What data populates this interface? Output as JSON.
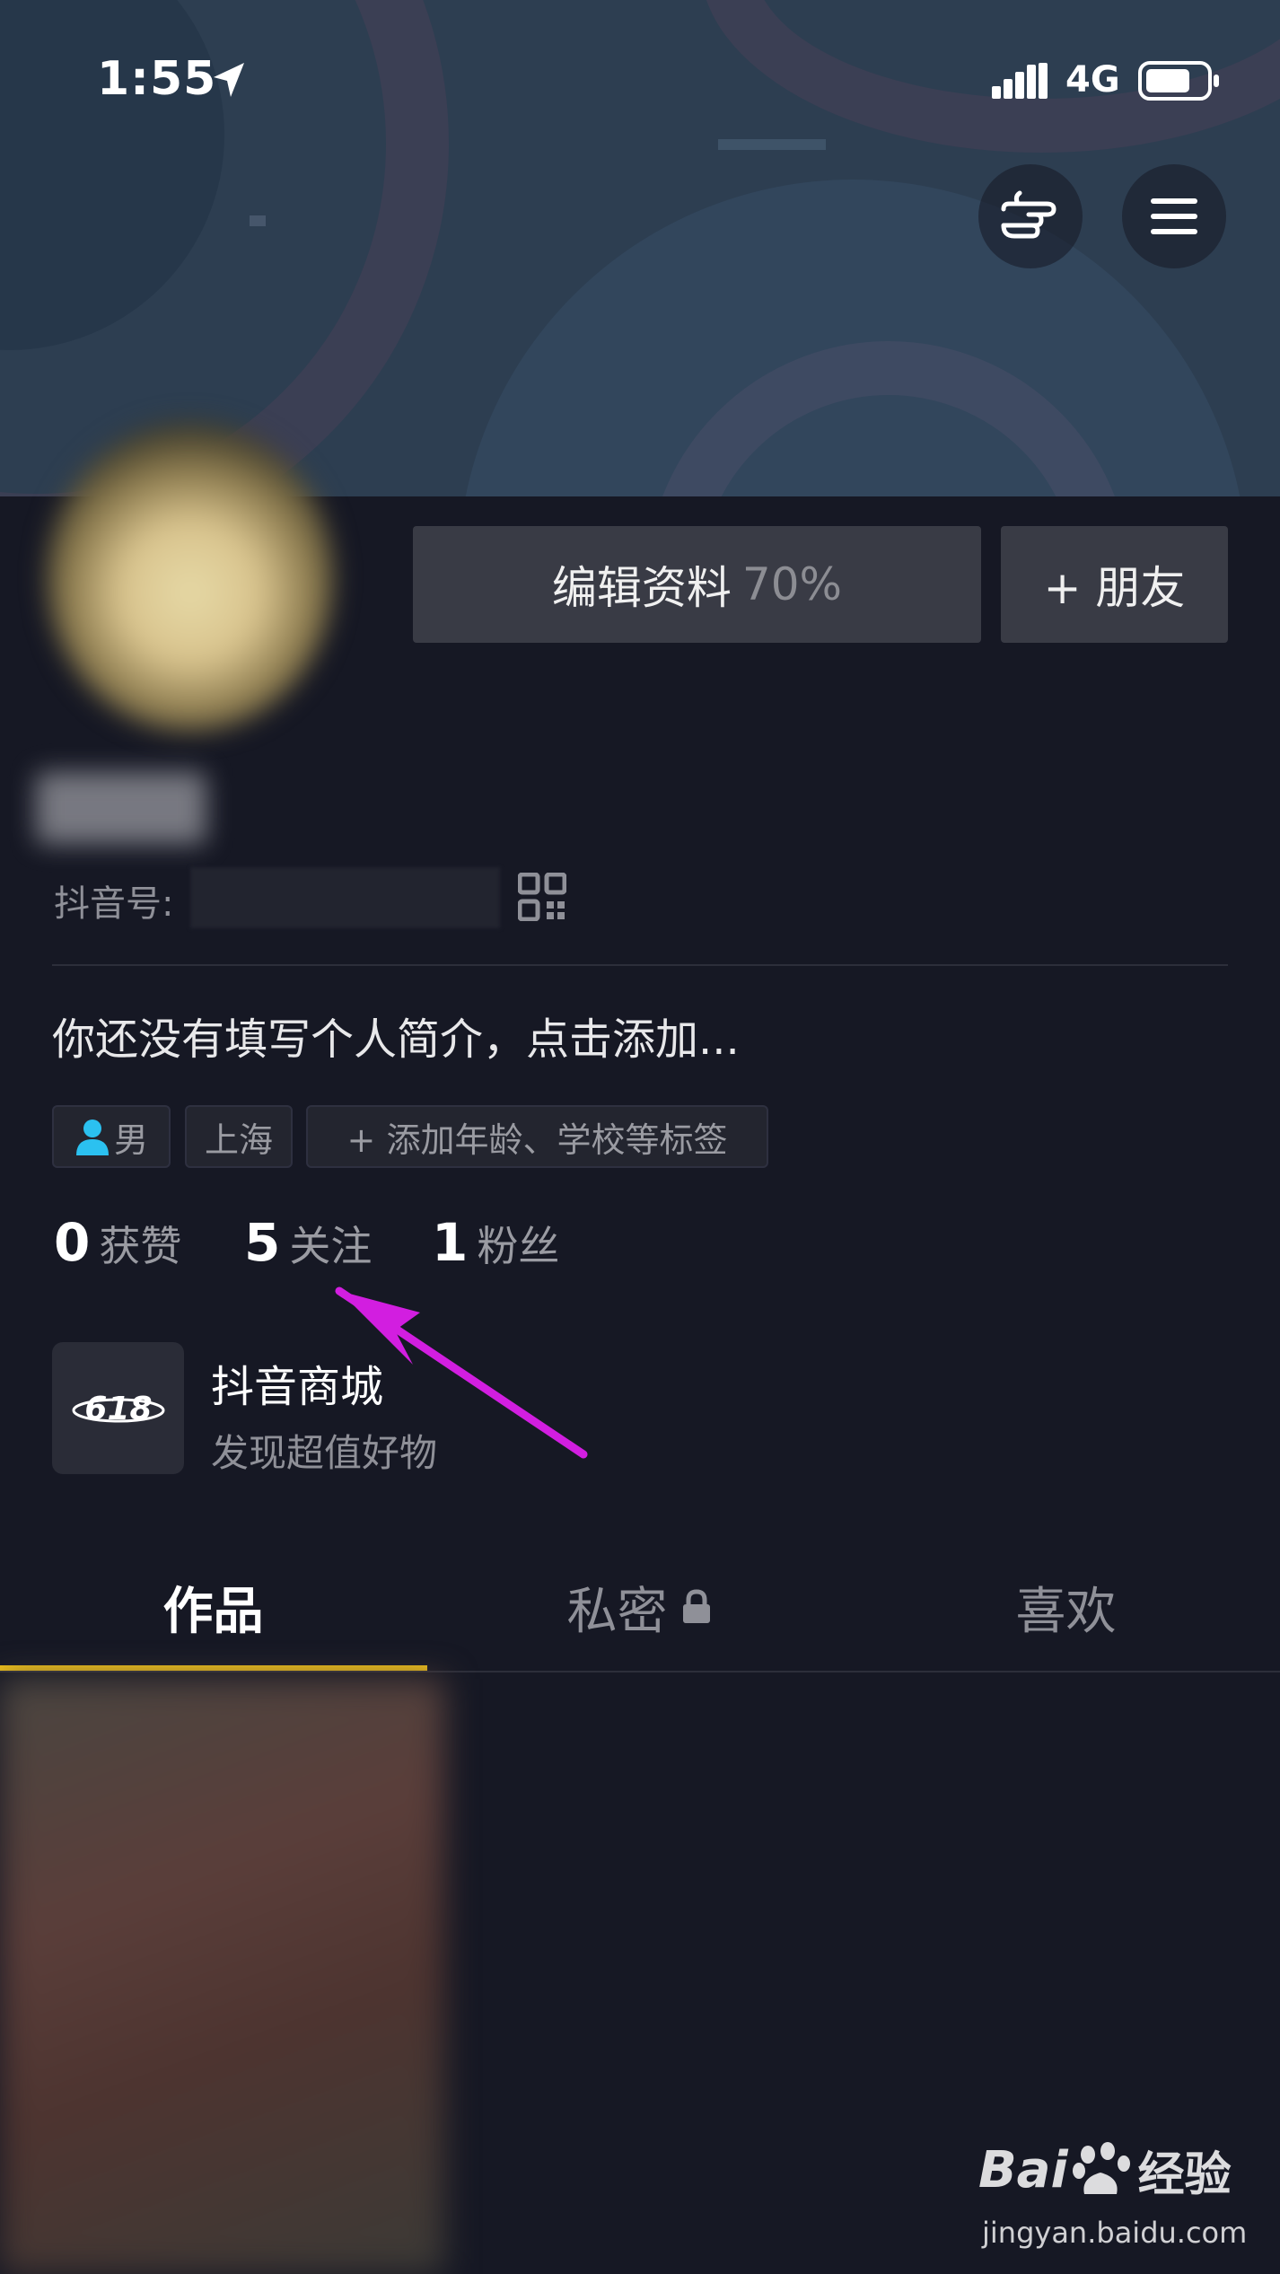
{
  "status_bar": {
    "time": "1:55",
    "network": "4G"
  },
  "header": {
    "edit_profile_label": "编辑资料",
    "profile_completion": "70%",
    "add_friend_label": "+ 朋友"
  },
  "profile": {
    "douyin_id_label": "抖音号:",
    "bio_placeholder": "你还没有填写个人简介，点击添加...",
    "tags": {
      "gender": "男",
      "location": "上海",
      "add_tags": "+ 添加年龄、学校等标签"
    },
    "stats": [
      {
        "num": "0",
        "label": "获赞"
      },
      {
        "num": "5",
        "label": "关注"
      },
      {
        "num": "1",
        "label": "粉丝"
      }
    ]
  },
  "shop": {
    "title": "抖音商城",
    "subtitle": "发现超值好物",
    "logo_text": "618"
  },
  "tabs": [
    {
      "label": "作品"
    },
    {
      "label": "私密"
    },
    {
      "label": "喜欢"
    }
  ],
  "watermark": {
    "brand": "Bai",
    "brand_cn": "经验",
    "url": "jingyan.baidu.com"
  },
  "colors": {
    "background": "#161824",
    "header": "#2d3e51",
    "active_tab_indicator": "#f5c518",
    "annotation_arrow": "#d21ee0",
    "gender_icon": "#2bc1f0"
  }
}
